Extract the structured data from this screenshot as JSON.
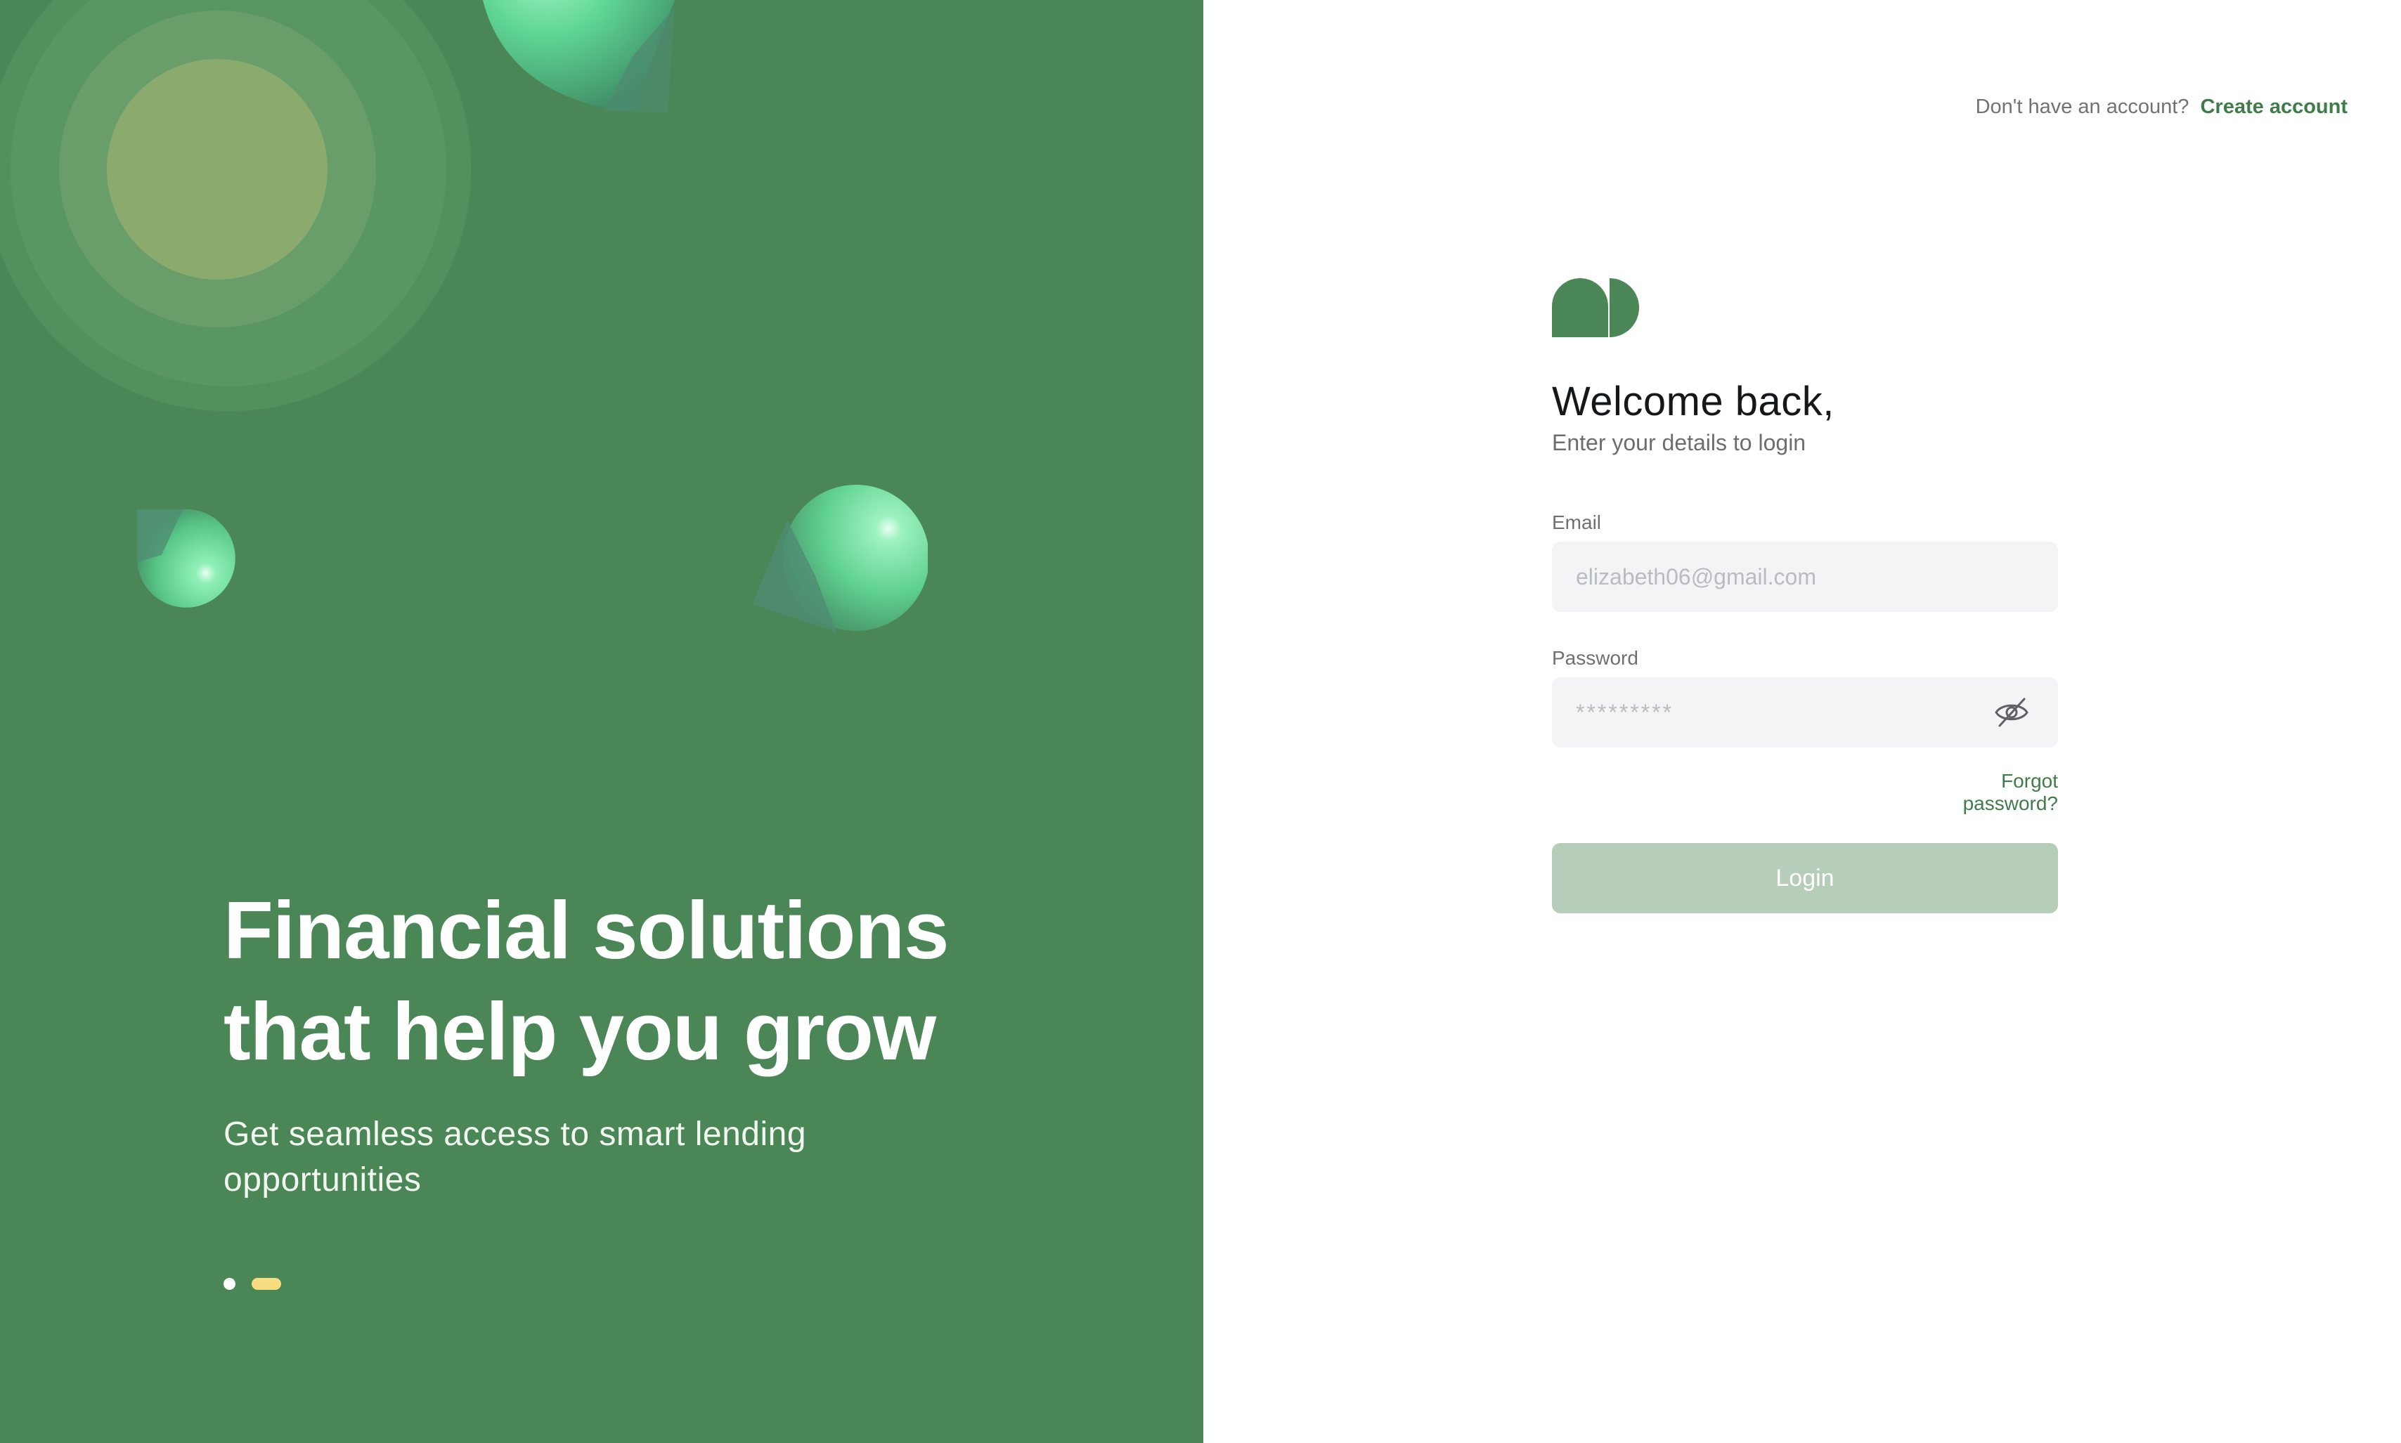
{
  "hero": {
    "title_line_1": "Financial solutions",
    "title_line_2": "that help you grow",
    "subtitle": "Get seamless access to smart lending opportunities",
    "carousel": {
      "slides": 2,
      "active_index": 1
    }
  },
  "auth": {
    "signup_prompt": "Don't have an account?",
    "signup_link": "Create account",
    "heading": "Welcome back,",
    "subheading": "Enter your details to login",
    "email_label": "Email",
    "email_placeholder": "elizabeth06@gmail.com",
    "password_label": "Password",
    "password_placeholder": "*********",
    "password_toggle_icon": "eye-off-icon",
    "forgot_password": "Forgot password?",
    "login_button": "Login"
  },
  "colors": {
    "brand_green": "#4a8656",
    "link_green": "#3f7c4a",
    "login_button_disabled": "#b6cdb9",
    "carousel_active": "#f7dc82",
    "input_background": "#f3f4f6"
  }
}
